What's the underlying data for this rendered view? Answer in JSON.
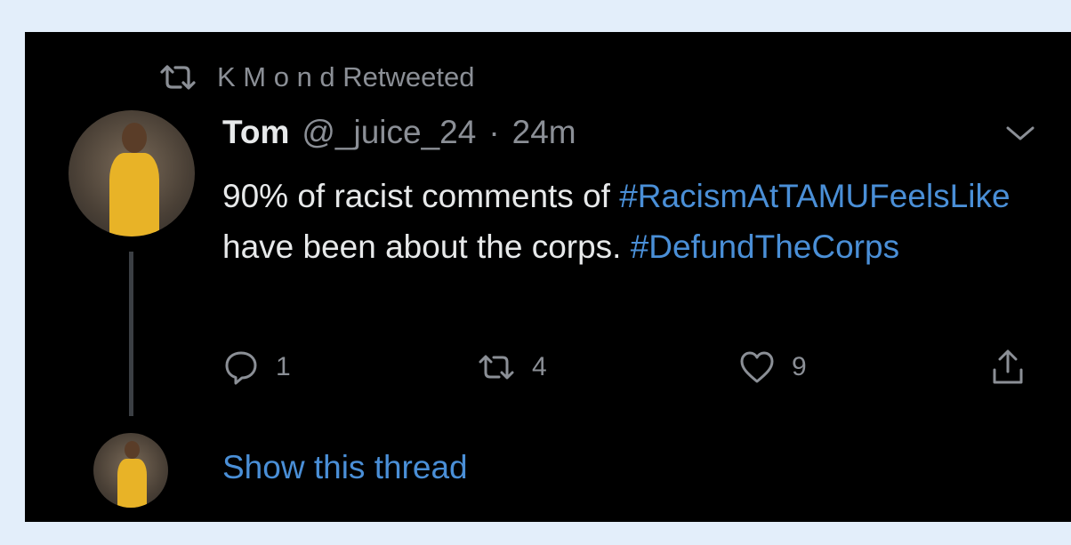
{
  "retweet_banner": {
    "label": "K M o n d Retweeted"
  },
  "tweet": {
    "author_name": "Tom",
    "handle": "@_juice_24",
    "separator": "·",
    "time": "24m",
    "text_parts": [
      {
        "text": "90% of racist comments of ",
        "hashtag": false
      },
      {
        "text": "#RacismAtTAMUFeelsLike",
        "hashtag": true
      },
      {
        "text": " have been about the corps. ",
        "hashtag": false
      },
      {
        "text": "#DefundTheCorps",
        "hashtag": true
      }
    ],
    "reply_count": "1",
    "retweet_count": "4",
    "like_count": "9"
  },
  "thread": {
    "show_thread_label": "Show this thread"
  },
  "colors": {
    "background": "#000000",
    "text": "#e7e9ea",
    "muted": "#8b8f96",
    "link": "#4a8fd7"
  },
  "icons": [
    "retweet-icon",
    "chevron-down-icon",
    "reply-icon",
    "like-icon",
    "share-icon"
  ]
}
